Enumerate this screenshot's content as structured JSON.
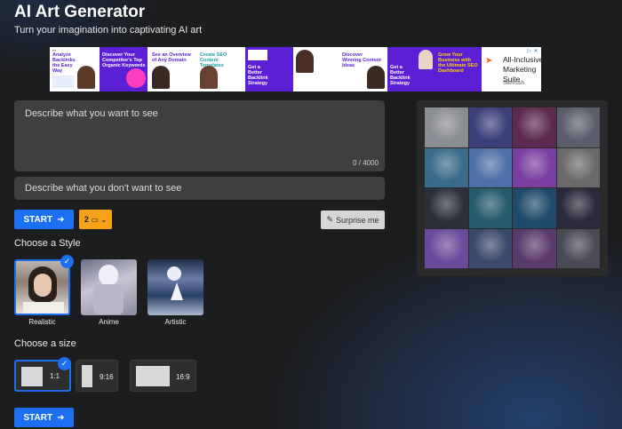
{
  "header": {
    "title": "AI Art Generator",
    "subtitle": "Turn your imagination into captivating AI art"
  },
  "ad": {
    "cards": [
      {
        "headline": "Analyze Backlinks the Easy Way",
        "color": "#5b1fd6"
      },
      {
        "headline": "Discover Your Competitor's Top Organic Keywords",
        "color": "#5b1fd6"
      },
      {
        "headline": "See an Overview of Any Domain",
        "color": "#5b1fd6"
      },
      {
        "headline": "Create SEO Content Templates",
        "color": "#1aa3a3"
      },
      {
        "headline": "Get a Better Backlink Strategy",
        "color": "#ffffff"
      },
      {
        "headline": "Discover Winning Content Ideas",
        "color": "#5b1fd6"
      },
      {
        "headline": "Get a Better Backlink Strategy",
        "color": "#ffffff"
      },
      {
        "headline": "Grow Your Business with the Ultimate SEO Dashboard",
        "color": "#ffd400"
      }
    ],
    "right_copy": "All-Inclusive Marketing Suite",
    "right_source": "Semrush"
  },
  "prompt": {
    "placeholder": "Describe what you want to see",
    "counter": "0 / 4000"
  },
  "negative_prompt": {
    "placeholder": "Describe what you don't want to see"
  },
  "controls": {
    "start_label": "START",
    "image_count": "2",
    "surprise_label": "Surprise me"
  },
  "style": {
    "heading": "Choose a Style",
    "options": [
      {
        "label": "Realistic",
        "selected": true
      },
      {
        "label": "Anime",
        "selected": false
      },
      {
        "label": "Artistic",
        "selected": false
      }
    ]
  },
  "size": {
    "heading": "Choose a size",
    "options": [
      {
        "label": "1:1",
        "selected": true
      },
      {
        "label": "9:16",
        "selected": false
      },
      {
        "label": "16:9",
        "selected": false
      }
    ]
  },
  "gallery": {
    "tiles": [
      "#8a8c93",
      "#3b3f7a",
      "#5c2a4f",
      "#5b5e6a",
      "#3a6b8a",
      "#4f6fa8",
      "#7a3fa0",
      "#6a6a6a",
      "#2b2f3a",
      "#245a6a",
      "#1f4a6a",
      "#2a2a3a",
      "#6a4a9a",
      "#3a4a6a",
      "#5a3a6a",
      "#4a4a55"
    ]
  },
  "colors": {
    "accent": "#1d6ff2",
    "count_button": "#f7a21b",
    "field_bg": "#3f3f3f"
  }
}
